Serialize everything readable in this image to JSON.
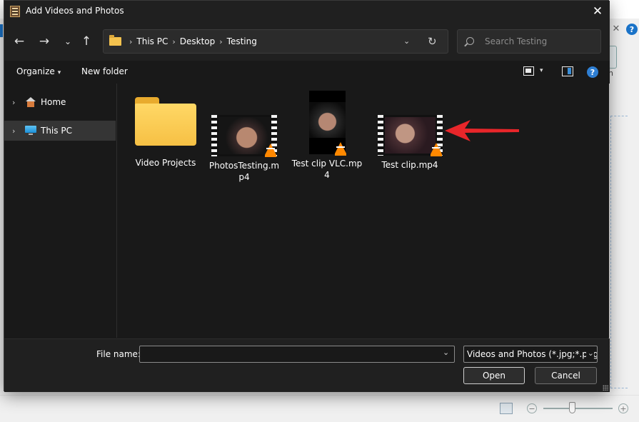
{
  "dialog": {
    "title": "Add Videos and Photos",
    "close_glyph": "✕"
  },
  "nav": {
    "back_glyph": "←",
    "forward_glyph": "→",
    "recent_glyph": "⌄",
    "up_glyph": "↑"
  },
  "address": {
    "crumbs": [
      "This PC",
      "Desktop",
      "Testing"
    ],
    "separator": "›",
    "dropdown_glyph": "⌄",
    "refresh_glyph": "↻"
  },
  "search": {
    "placeholder": "Search Testing",
    "value": ""
  },
  "toolbar": {
    "organize_label": "Organize",
    "caret": "▾",
    "new_folder_label": "New folder",
    "help_glyph": "?"
  },
  "sidebar": {
    "items": [
      {
        "label": "Home",
        "icon": "home-icon",
        "selected": false
      },
      {
        "label": "This PC",
        "icon": "computer-icon",
        "selected": true
      }
    ],
    "chevron": "›"
  },
  "files": [
    {
      "name": "Video Projects",
      "type": "folder"
    },
    {
      "name": "PhotosTesting.mp4",
      "type": "video"
    },
    {
      "name": "Test clip VLC.mp4",
      "type": "video-portrait"
    },
    {
      "name": "Test clip.mp4",
      "type": "video"
    }
  ],
  "footer": {
    "file_name_label": "File name:",
    "file_name_value": "",
    "file_type_value": "Videos and Photos (*.jpg;*.png;",
    "dropdown_glyph": "⌄",
    "open_label": "Open",
    "cancel_label": "Cancel"
  },
  "background": {
    "help_glyph": "?",
    "close_glyph": "✕",
    "button_label": "n",
    "zoom_minus": "−",
    "zoom_plus": "+"
  },
  "colors": {
    "accent": "#2f7fd3",
    "annotation_arrow": "#e8262a",
    "folder": "#f6c044"
  }
}
